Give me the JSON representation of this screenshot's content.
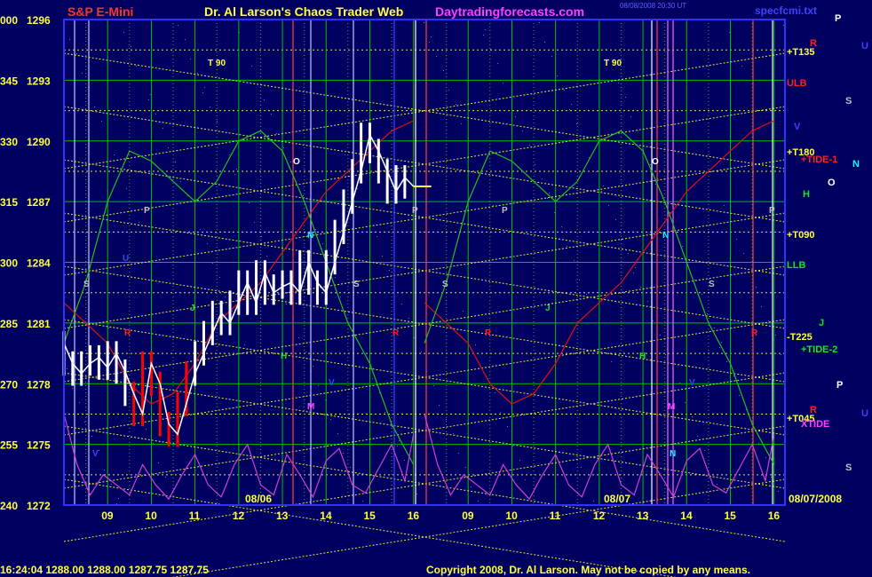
{
  "header": {
    "symbol": "S&P E-Mini",
    "title": "Dr. Al Larson's Chaos Trader Web",
    "site": "Daytradingforecasts.com",
    "stamp1": "08/08/2008 20:30 UT",
    "file": "specfcmi.txt"
  },
  "footer": {
    "quote": "16:24:04   1288.00  1288.00  1287.75  1287.75",
    "copyright": "Copyright 2008, Dr. Al Larson. May not be copied by any means."
  },
  "colors": {
    "background": "#000060",
    "grid_green": "#00c000",
    "grid_yellow": "#e8e840",
    "price": "#ffffff",
    "price_down": "#ff0000",
    "sky": "#00c8ff",
    "tide_red": "#e01010",
    "tide_green": "#20c020",
    "tide_magenta": "#d040d0",
    "axis_blue": "#3030ff"
  },
  "chart_data": {
    "type": "line",
    "y_axis_left": {
      "labels": [
        {
          "osc": "000",
          "price": "1296"
        },
        {
          "osc": "345",
          "price": "1293"
        },
        {
          "osc": "330",
          "price": "1290"
        },
        {
          "osc": "315",
          "price": "1287"
        },
        {
          "osc": "300",
          "price": "1284"
        },
        {
          "osc": "285",
          "price": "1281"
        },
        {
          "osc": "270",
          "price": "1278"
        },
        {
          "osc": "255",
          "price": "1275"
        },
        {
          "osc": "240",
          "price": "1272"
        }
      ],
      "ylim": [
        1272,
        1296
      ]
    },
    "x_ticks": [
      "09",
      "10",
      "11",
      "12",
      "13",
      "14",
      "15",
      "16",
      "09",
      "10",
      "11",
      "12",
      "13",
      "14",
      "15",
      "16"
    ],
    "date_labels": [
      "08/06",
      "08/07",
      "08/07/2008"
    ],
    "right_labels": [
      {
        "text": "+T135",
        "color": "#ffff40"
      },
      {
        "text": "ULB",
        "color": "#ff2020"
      },
      {
        "text": "+T180",
        "color": "#ffff40"
      },
      {
        "text": "+TIDE-1",
        "color": "#ff2020"
      },
      {
        "text": "+T090",
        "color": "#ffff40"
      },
      {
        "text": "LLB",
        "color": "#20e020"
      },
      {
        "text": "-T225",
        "color": "#ffff40"
      },
      {
        "text": "+TIDE-2",
        "color": "#20e020"
      },
      {
        "text": "+T045",
        "color": "#ffff40"
      },
      {
        "text": "XTIDE",
        "color": "#ff40ff"
      }
    ],
    "planet_letters": [
      {
        "text": "P",
        "color": "#ffffff"
      },
      {
        "text": "U",
        "color": "#4040ff"
      },
      {
        "text": "R",
        "color": "#ff2020"
      },
      {
        "text": "S",
        "color": "#c0c0c0"
      },
      {
        "text": "V",
        "color": "#4040ff"
      },
      {
        "text": "N",
        "color": "#00ffff"
      },
      {
        "text": "O",
        "color": "#ffffff"
      },
      {
        "text": "H",
        "color": "#20e020"
      },
      {
        "text": "J",
        "color": "#20e020"
      },
      {
        "text": "P",
        "color": "#ffffff"
      },
      {
        "text": "U",
        "color": "#4040ff"
      },
      {
        "text": "R",
        "color": "#ff2020"
      },
      {
        "text": "S",
        "color": "#c0c0c0"
      }
    ],
    "chart_letters": [
      {
        "text": "T 90",
        "color": "#ffff40"
      },
      {
        "text": "T 90",
        "color": "#ffff40"
      },
      {
        "text": "O",
        "color": "#ffffff"
      },
      {
        "text": "O",
        "color": "#ffffff"
      },
      {
        "text": "P",
        "color": "#c0c0c0"
      },
      {
        "text": "P",
        "color": "#c0c0c0"
      },
      {
        "text": "P",
        "color": "#c0c0c0"
      },
      {
        "text": "P",
        "color": "#c0c0c0"
      },
      {
        "text": "N",
        "color": "#00ffff"
      },
      {
        "text": "N",
        "color": "#00ffff"
      },
      {
        "text": "U",
        "color": "#4040ff"
      },
      {
        "text": "S",
        "color": "#c0c0c0"
      },
      {
        "text": "S",
        "color": "#c0c0c0"
      },
      {
        "text": "S",
        "color": "#c0c0c0"
      },
      {
        "text": "S",
        "color": "#c0c0c0"
      },
      {
        "text": "R",
        "color": "#ff2020"
      },
      {
        "text": "R",
        "color": "#ff2020"
      },
      {
        "text": "R",
        "color": "#ff2020"
      },
      {
        "text": "R",
        "color": "#ff2020"
      },
      {
        "text": "J",
        "color": "#20e020"
      },
      {
        "text": "J",
        "color": "#20e020"
      },
      {
        "text": "H",
        "color": "#20e020"
      },
      {
        "text": "H",
        "color": "#20e020"
      },
      {
        "text": "M",
        "color": "#ff40ff"
      },
      {
        "text": "M",
        "color": "#ff40ff"
      },
      {
        "text": "V",
        "color": "#4040ff"
      },
      {
        "text": "V",
        "color": "#4040ff"
      },
      {
        "text": "V",
        "color": "#4040ff"
      },
      {
        "text": "N",
        "color": "#00ffff"
      }
    ],
    "price_series": {
      "name": "",
      "color": "#ffffff",
      "x_hours": [
        8.0,
        8.2,
        8.4,
        8.6,
        8.8,
        9.0,
        9.2,
        9.4,
        9.6,
        9.8,
        10.0,
        10.2,
        10.4,
        10.6,
        10.8,
        11.0,
        11.2,
        11.4,
        11.6,
        11.8,
        12.0,
        12.2,
        12.4,
        12.6,
        12.8,
        13.0,
        13.2,
        13.4,
        13.6,
        13.8,
        14.0,
        14.2,
        14.4,
        14.6,
        14.8,
        15.0,
        15.2,
        15.4,
        15.6,
        15.8,
        16.0
      ],
      "values": [
        1280,
        1279,
        1278.5,
        1279,
        1279.3,
        1278.8,
        1279.5,
        1278.6,
        1277.5,
        1276.5,
        1279,
        1278,
        1276,
        1275.5,
        1277,
        1278.5,
        1279.5,
        1280.5,
        1281.5,
        1281,
        1282,
        1283,
        1282,
        1283.5,
        1282.5,
        1282.8,
        1283,
        1282.5,
        1284,
        1283,
        1282.5,
        1284,
        1285.5,
        1287,
        1288.5,
        1290.3,
        1289.5,
        1288.5,
        1287.5,
        1288.2,
        1287.75
      ]
    },
    "tide1_series": {
      "name": "",
      "color": "#e01010",
      "x_hours": [
        8.0,
        8.5,
        9.0,
        9.5,
        10.0,
        10.5,
        11.0,
        11.5,
        12.0,
        12.5,
        13.0,
        13.5,
        14.0,
        14.5,
        15.0,
        15.5,
        16.0
      ],
      "values": [
        1282,
        1281,
        1280,
        1278,
        1277,
        1277.5,
        1279,
        1281,
        1282,
        1283,
        1284.5,
        1286,
        1287.5,
        1288.5,
        1289.5,
        1290.5,
        1291
      ]
    },
    "tide2_series": {
      "name": "",
      "color": "#20c020",
      "x_hours": [
        8.0,
        8.5,
        9.0,
        9.5,
        10.0,
        10.5,
        11.0,
        11.5,
        12.0,
        12.5,
        13.0,
        13.5,
        14.0,
        14.5,
        15.0,
        15.5,
        16.0
      ],
      "values": [
        1280,
        1283,
        1287,
        1289.5,
        1289,
        1288,
        1287,
        1288,
        1290,
        1290.5,
        1289.5,
        1287,
        1284,
        1281,
        1279,
        1276,
        1274
      ]
    },
    "xtide_series": {
      "name": "",
      "color": "#d040d0",
      "x_hours": [
        8.0,
        8.3,
        8.6,
        8.9,
        9.2,
        9.5,
        9.8,
        10.1,
        10.4,
        10.7,
        11.0,
        11.3,
        11.6,
        11.9,
        12.2,
        12.5,
        12.8,
        13.1,
        13.4,
        13.7,
        14.0,
        14.3,
        14.6,
        14.9,
        15.2,
        15.5,
        15.8,
        16.0
      ],
      "values": [
        1276.5,
        1274,
        1272.5,
        1273.5,
        1273,
        1272.5,
        1274,
        1273,
        1272.3,
        1273.5,
        1274.5,
        1273,
        1272.4,
        1274,
        1275,
        1273,
        1272.5,
        1274.5,
        1273.5,
        1272.4,
        1274.2,
        1274.8,
        1273,
        1272.6,
        1273.8,
        1275,
        1273.2,
        1275.5
      ]
    }
  }
}
